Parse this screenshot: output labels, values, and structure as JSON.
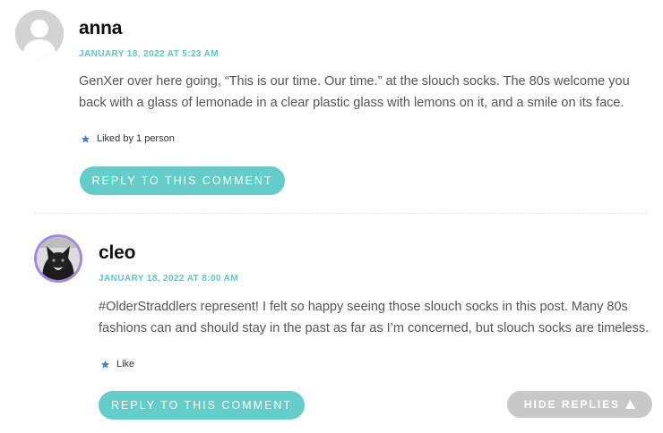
{
  "comments": [
    {
      "author": "anna",
      "date": "JANUARY 18, 2022 AT 5:23 AM",
      "text_line1": "GenXer over here going, “This is our time. Our time.” at the slouch socks. The 80s welcome you",
      "text_line2": "back with a glass of lemonade in a clear plastic glass with lemons on it, and a smile on its face.",
      "likes": "Liked by 1 person",
      "reply_label": "REPLY TO THIS COMMENT"
    },
    {
      "author": "cleo",
      "date": "JANUARY 18, 2022 AT 8:00 AM",
      "text_line1": "#OlderStraddlers represent! I felt so happy seeing those slouch socks in this post. Many 80s",
      "text_line2": "fashions can and should stay in the past as far as I’m concerned, but slouch socks are timeless.",
      "likes": "Like",
      "reply_label": "REPLY TO THIS COMMENT"
    }
  ],
  "hide_replies_label": "HIDE REPLIES",
  "colors": {
    "accent": "#65cdc9",
    "date": "#5fc6c4",
    "hide_button": "#c8c8c8",
    "cleo_avatar_ring": "#a188e0",
    "like_star": "#3b88c8"
  },
  "icons": {
    "anna_avatar": "default-user-silhouette-icon",
    "cleo_avatar": "cat-photo-avatar",
    "like": "star-icon",
    "hide_replies": "triangle-up-icon"
  }
}
